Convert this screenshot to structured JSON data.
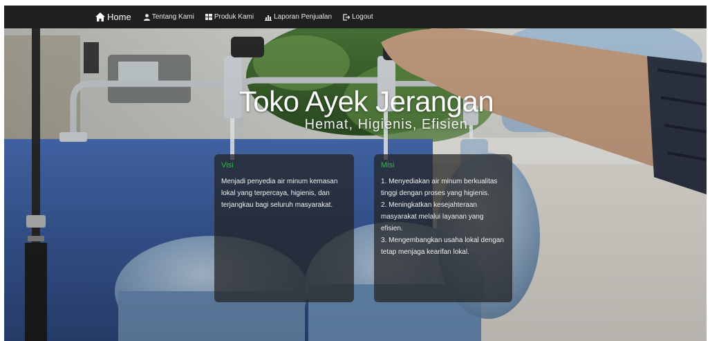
{
  "navbar": {
    "items": [
      {
        "label": "Home",
        "icon": "home-icon"
      },
      {
        "label": "Tentang Kami",
        "icon": "user-icon"
      },
      {
        "label": "Produk Kami",
        "icon": "grid-icon"
      },
      {
        "label": "Laporan Penjualan",
        "icon": "chart-icon"
      },
      {
        "label": "Logout",
        "icon": "logout-icon"
      }
    ]
  },
  "hero": {
    "title": "Toko Ayek Jerangan",
    "subtitle": "Hemat, Higienis, Efisien."
  },
  "visi": {
    "heading": "Visi",
    "text": "Menjadi penyedia air minum kemasan lokal yang terpercaya, higienis, dan terjangkau bagi seluruh masyarakat."
  },
  "misi": {
    "heading": "Misi",
    "items": [
      "1. Menyediakan air minum berkualitas tinggi dengan proses yang higienis.",
      "2. Meningkatkan kesejahteraan masyarakat melalui layanan yang efisien.",
      "3. Mengembangkan usaha lokal dengan tetap menjaga kearifan lokal."
    ]
  },
  "colors": {
    "navbar_bg": "#1f1f1f",
    "heading_green": "#37b24d",
    "card_bg": "rgba(35,35,35,0.72)"
  }
}
